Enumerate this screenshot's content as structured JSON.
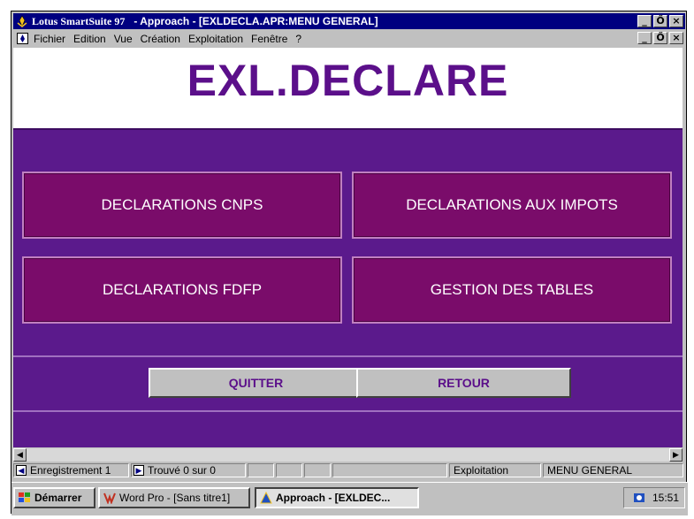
{
  "window": {
    "app_name": "Lotus SmartSuite 97",
    "title": "- Approach - [EXLDECLA.APR:MENU GENERAL]",
    "controls": [
      "_",
      "Ő",
      "×"
    ]
  },
  "menu": {
    "items": [
      "Fichier",
      "Edition",
      "Vue",
      "Création",
      "Exploitation",
      "Fenêtre",
      "?"
    ]
  },
  "form": {
    "title": "EXL.DECLARE",
    "buttons": {
      "cnps": "DECLARATIONS CNPS",
      "impots": "DECLARATIONS AUX IMPOTS",
      "fdfp": "DECLARATIONS FDFP",
      "tables": "GESTION DES TABLES"
    },
    "quitter": "QUITTER",
    "retour": "RETOUR",
    "colors": {
      "background": "#5b1a8c",
      "button": "#7a0c6a",
      "title": "#5b0f8a"
    }
  },
  "statusbar": {
    "record": "Enregistrement 1",
    "found": "Trouvé 0 sur 0",
    "mode": "Exploitation",
    "view": "MENU GENERAL"
  },
  "taskbar": {
    "start": "Démarrer",
    "items": [
      "Word Pro - [Sans titre1]",
      "Approach - [EXLDEC..."
    ],
    "clock": "15:51"
  }
}
